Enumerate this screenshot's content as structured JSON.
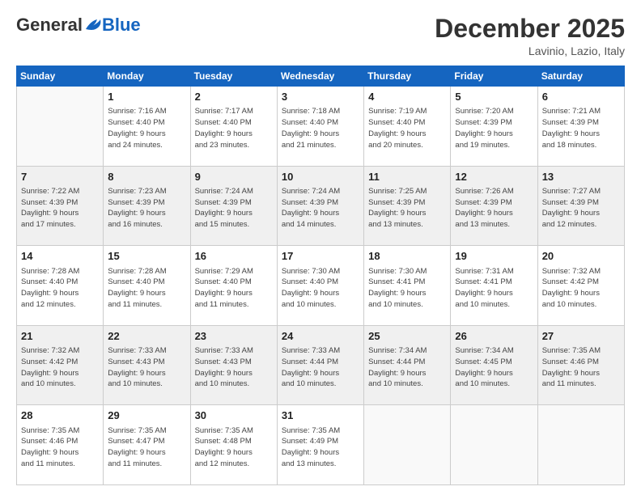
{
  "logo": {
    "general": "General",
    "blue": "Blue"
  },
  "title": "December 2025",
  "location": "Lavinio, Lazio, Italy",
  "days_header": [
    "Sunday",
    "Monday",
    "Tuesday",
    "Wednesday",
    "Thursday",
    "Friday",
    "Saturday"
  ],
  "weeks": [
    [
      {
        "num": "",
        "info": ""
      },
      {
        "num": "1",
        "info": "Sunrise: 7:16 AM\nSunset: 4:40 PM\nDaylight: 9 hours\nand 24 minutes."
      },
      {
        "num": "2",
        "info": "Sunrise: 7:17 AM\nSunset: 4:40 PM\nDaylight: 9 hours\nand 23 minutes."
      },
      {
        "num": "3",
        "info": "Sunrise: 7:18 AM\nSunset: 4:40 PM\nDaylight: 9 hours\nand 21 minutes."
      },
      {
        "num": "4",
        "info": "Sunrise: 7:19 AM\nSunset: 4:40 PM\nDaylight: 9 hours\nand 20 minutes."
      },
      {
        "num": "5",
        "info": "Sunrise: 7:20 AM\nSunset: 4:39 PM\nDaylight: 9 hours\nand 19 minutes."
      },
      {
        "num": "6",
        "info": "Sunrise: 7:21 AM\nSunset: 4:39 PM\nDaylight: 9 hours\nand 18 minutes."
      }
    ],
    [
      {
        "num": "7",
        "info": "Sunrise: 7:22 AM\nSunset: 4:39 PM\nDaylight: 9 hours\nand 17 minutes."
      },
      {
        "num": "8",
        "info": "Sunrise: 7:23 AM\nSunset: 4:39 PM\nDaylight: 9 hours\nand 16 minutes."
      },
      {
        "num": "9",
        "info": "Sunrise: 7:24 AM\nSunset: 4:39 PM\nDaylight: 9 hours\nand 15 minutes."
      },
      {
        "num": "10",
        "info": "Sunrise: 7:24 AM\nSunset: 4:39 PM\nDaylight: 9 hours\nand 14 minutes."
      },
      {
        "num": "11",
        "info": "Sunrise: 7:25 AM\nSunset: 4:39 PM\nDaylight: 9 hours\nand 13 minutes."
      },
      {
        "num": "12",
        "info": "Sunrise: 7:26 AM\nSunset: 4:39 PM\nDaylight: 9 hours\nand 13 minutes."
      },
      {
        "num": "13",
        "info": "Sunrise: 7:27 AM\nSunset: 4:39 PM\nDaylight: 9 hours\nand 12 minutes."
      }
    ],
    [
      {
        "num": "14",
        "info": "Sunrise: 7:28 AM\nSunset: 4:40 PM\nDaylight: 9 hours\nand 12 minutes."
      },
      {
        "num": "15",
        "info": "Sunrise: 7:28 AM\nSunset: 4:40 PM\nDaylight: 9 hours\nand 11 minutes."
      },
      {
        "num": "16",
        "info": "Sunrise: 7:29 AM\nSunset: 4:40 PM\nDaylight: 9 hours\nand 11 minutes."
      },
      {
        "num": "17",
        "info": "Sunrise: 7:30 AM\nSunset: 4:40 PM\nDaylight: 9 hours\nand 10 minutes."
      },
      {
        "num": "18",
        "info": "Sunrise: 7:30 AM\nSunset: 4:41 PM\nDaylight: 9 hours\nand 10 minutes."
      },
      {
        "num": "19",
        "info": "Sunrise: 7:31 AM\nSunset: 4:41 PM\nDaylight: 9 hours\nand 10 minutes."
      },
      {
        "num": "20",
        "info": "Sunrise: 7:32 AM\nSunset: 4:42 PM\nDaylight: 9 hours\nand 10 minutes."
      }
    ],
    [
      {
        "num": "21",
        "info": "Sunrise: 7:32 AM\nSunset: 4:42 PM\nDaylight: 9 hours\nand 10 minutes."
      },
      {
        "num": "22",
        "info": "Sunrise: 7:33 AM\nSunset: 4:43 PM\nDaylight: 9 hours\nand 10 minutes."
      },
      {
        "num": "23",
        "info": "Sunrise: 7:33 AM\nSunset: 4:43 PM\nDaylight: 9 hours\nand 10 minutes."
      },
      {
        "num": "24",
        "info": "Sunrise: 7:33 AM\nSunset: 4:44 PM\nDaylight: 9 hours\nand 10 minutes."
      },
      {
        "num": "25",
        "info": "Sunrise: 7:34 AM\nSunset: 4:44 PM\nDaylight: 9 hours\nand 10 minutes."
      },
      {
        "num": "26",
        "info": "Sunrise: 7:34 AM\nSunset: 4:45 PM\nDaylight: 9 hours\nand 10 minutes."
      },
      {
        "num": "27",
        "info": "Sunrise: 7:35 AM\nSunset: 4:46 PM\nDaylight: 9 hours\nand 11 minutes."
      }
    ],
    [
      {
        "num": "28",
        "info": "Sunrise: 7:35 AM\nSunset: 4:46 PM\nDaylight: 9 hours\nand 11 minutes."
      },
      {
        "num": "29",
        "info": "Sunrise: 7:35 AM\nSunset: 4:47 PM\nDaylight: 9 hours\nand 11 minutes."
      },
      {
        "num": "30",
        "info": "Sunrise: 7:35 AM\nSunset: 4:48 PM\nDaylight: 9 hours\nand 12 minutes."
      },
      {
        "num": "31",
        "info": "Sunrise: 7:35 AM\nSunset: 4:49 PM\nDaylight: 9 hours\nand 13 minutes."
      },
      {
        "num": "",
        "info": ""
      },
      {
        "num": "",
        "info": ""
      },
      {
        "num": "",
        "info": ""
      }
    ]
  ]
}
